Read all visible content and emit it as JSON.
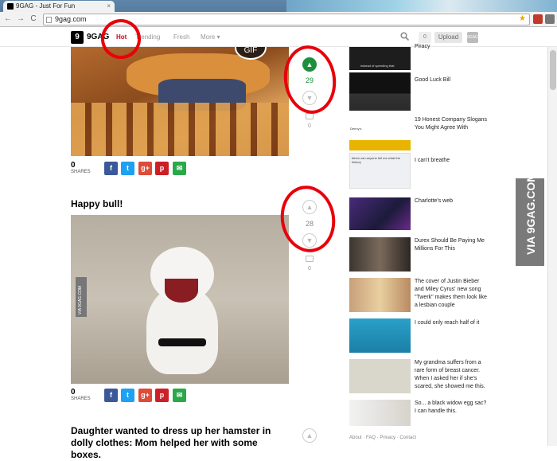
{
  "browser": {
    "tab_title": "9GAG - Just For Fun",
    "tab_close": "×",
    "url": "9gag.com",
    "back": "←",
    "forward": "→",
    "reload": "C",
    "star": "★"
  },
  "nav": {
    "logo_mark": "9",
    "logo_text": "9GAG",
    "items": [
      "Hot",
      "Trending",
      "Fresh",
      "More ▾"
    ],
    "count": "0",
    "upload_label": "Upload",
    "avatar_text": "9GAG"
  },
  "watermark": "VIA 9GAG.COM",
  "posts": [
    {
      "gif_badge": "GIF",
      "shares_count": "0",
      "shares_label": "SHARES",
      "votes": "29",
      "comments": "0"
    },
    {
      "title": "Happy bull!",
      "image_watermark": "VIA 9GAG.COM",
      "shares_count": "0",
      "shares_label": "SHARES",
      "votes": "28",
      "comments": "0"
    },
    {
      "title": "Daughter wanted to dress up her hamster in dolly clothes: Mom helped her with some boxes."
    }
  ],
  "share_buttons": [
    "f",
    "t",
    "g+",
    "p",
    "✉"
  ],
  "sidebar": [
    {
      "title": "Piracy",
      "thumb_caption": "instead of spending that"
    },
    {
      "title": "Good Luck Bill"
    },
    {
      "title": "19 Honest Company Slogans You Might Agree With",
      "thumb_caption": "Denny's"
    },
    {
      "title": "I can't breathe",
      "thumb_caption": "tdrion can anyone tell me what the history"
    },
    {
      "title": "Charlotte's web"
    },
    {
      "title": "Durex Should Be Paying Me Millions For This"
    },
    {
      "title": "The cover of Justin Bieber and Miley Cyrus' new song \"Twerk\" makes them look like a lesbian couple"
    },
    {
      "title": "I could only reach half of it"
    },
    {
      "title": "My grandma suffers from a rare form of breast cancer. When I asked her if she's scared, she showed me this."
    },
    {
      "title": "So... a black widow egg sac? I can handle this."
    }
  ],
  "footer": "About · FAQ · Privacy · Contact",
  "colors": {
    "hot_red": "#d0021b",
    "upvote_green": "#1f8e3d",
    "annotation_red": "#e8000b",
    "facebook": "#3b5998",
    "twitter": "#1da1f2",
    "googleplus": "#dd4b39",
    "pinterest": "#cb2027",
    "email": "#2aa84a"
  }
}
